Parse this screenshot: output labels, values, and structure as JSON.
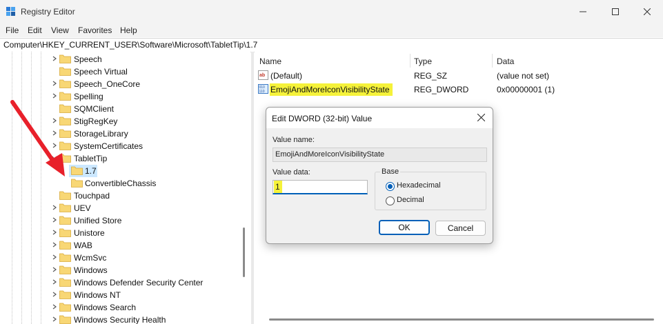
{
  "window": {
    "title": "Registry Editor",
    "minimize": "—",
    "maximize": "☐",
    "close": "✕"
  },
  "menu": [
    "File",
    "Edit",
    "View",
    "Favorites",
    "Help"
  ],
  "address": "Computer\\HKEY_CURRENT_USER\\Software\\Microsoft\\TabletTip\\1.7",
  "tree": [
    {
      "label": "Speech",
      "expander": ">",
      "child": false
    },
    {
      "label": "Speech Virtual",
      "expander": "",
      "child": false
    },
    {
      "label": "Speech_OneCore",
      "expander": ">",
      "child": false
    },
    {
      "label": "Spelling",
      "expander": ">",
      "child": false
    },
    {
      "label": "SQMClient",
      "expander": "",
      "child": false
    },
    {
      "label": "StigRegKey",
      "expander": ">",
      "child": false
    },
    {
      "label": "StorageLibrary",
      "expander": ">",
      "child": false
    },
    {
      "label": "SystemCertificates",
      "expander": ">",
      "child": false
    },
    {
      "label": "TabletTip",
      "expander": "v",
      "child": false
    },
    {
      "label": "1.7",
      "expander": "",
      "child": true,
      "selected": true
    },
    {
      "label": "ConvertibleChassis",
      "expander": "",
      "child": true
    },
    {
      "label": "Touchpad",
      "expander": "",
      "child": false
    },
    {
      "label": "UEV",
      "expander": ">",
      "child": false
    },
    {
      "label": "Unified Store",
      "expander": ">",
      "child": false
    },
    {
      "label": "Unistore",
      "expander": ">",
      "child": false
    },
    {
      "label": "WAB",
      "expander": ">",
      "child": false
    },
    {
      "label": "WcmSvc",
      "expander": ">",
      "child": false
    },
    {
      "label": "Windows",
      "expander": ">",
      "child": false
    },
    {
      "label": "Windows Defender Security Center",
      "expander": ">",
      "child": false
    },
    {
      "label": "Windows NT",
      "expander": ">",
      "child": false
    },
    {
      "label": "Windows Search",
      "expander": ">",
      "child": false
    },
    {
      "label": "Windows Security Health",
      "expander": ">",
      "child": false
    }
  ],
  "list": {
    "columns": {
      "name": "Name",
      "type": "Type",
      "data": "Data"
    },
    "rows": [
      {
        "name": "(Default)",
        "type": "REG_SZ",
        "data": "(value not set)",
        "icon": "string-value-icon"
      },
      {
        "name": "EmojiAndMoreIconVisibilityState",
        "type": "REG_DWORD",
        "data": "0x00000001 (1)",
        "icon": "dword-value-icon",
        "highlight": "#f5f23a"
      }
    ]
  },
  "dialog": {
    "title": "Edit DWORD (32-bit) Value",
    "close": "✕",
    "value_name_label": "Value name:",
    "value_name": "EmojiAndMoreIconVisibilityState",
    "value_data_label": "Value data:",
    "value_data": "1",
    "base_label": "Base",
    "base_options": [
      {
        "label": "Hexadecimal",
        "checked": true
      },
      {
        "label": "Decimal",
        "checked": false
      }
    ],
    "ok_label": "OK",
    "cancel_label": "Cancel"
  },
  "colors": {
    "accent": "#005fb8",
    "highlight": "#f5f23a",
    "arrow": "#e8202a",
    "folder": "#f8d775"
  }
}
